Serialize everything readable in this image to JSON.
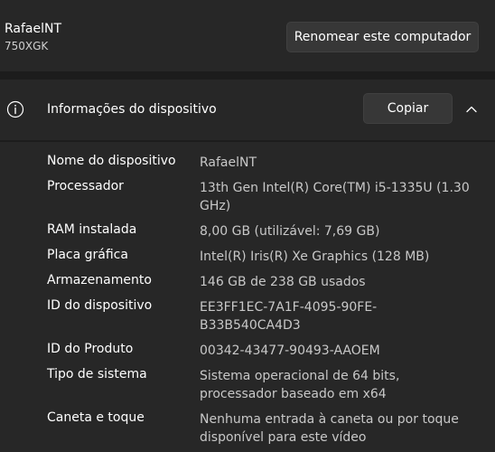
{
  "computer": {
    "name": "RafaelNT",
    "model": "750XGK",
    "rename_label": "Renomear este computador"
  },
  "device_info": {
    "title": "Informações do dispositivo",
    "copy_label": "Copiar",
    "icon": "info-icon",
    "expand_icon": "chevron-up-icon",
    "specs": [
      {
        "label": "Nome do dispositivo",
        "value": "RafaelNT"
      },
      {
        "label": "Processador",
        "value": "13th Gen Intel(R) Core(TM) i5-1335U (1.30 GHz)"
      },
      {
        "label": "RAM instalada",
        "value": "8,00 GB (utilizável: 7,69 GB)"
      },
      {
        "label": "Placa gráfica",
        "value": "Intel(R) Iris(R) Xe Graphics (128 MB)"
      },
      {
        "label": "Armazenamento",
        "value": "146 GB de 238 GB usados"
      },
      {
        "label": "ID do dispositivo",
        "value": "EE3FF1EC-7A1F-4095-90FE-B33B540CA4D3"
      },
      {
        "label": "ID do Produto",
        "value": "00342-43477-90493-AAOEM"
      },
      {
        "label": "Tipo de sistema",
        "value": "Sistema operacional de 64 bits, processador baseado em x64"
      },
      {
        "label": "Caneta e toque",
        "value": "Nenhuma entrada à caneta ou por toque disponível para este vídeo"
      }
    ]
  },
  "colors": {
    "card_bg": "#272727",
    "page_bg": "#1c1c1c",
    "button_bg": "#373737",
    "value_text": "#c8c8c8"
  }
}
